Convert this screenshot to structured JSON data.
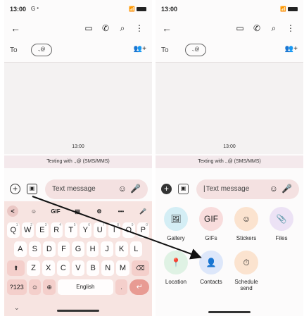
{
  "left": {
    "status": {
      "time": "13:00",
      "extra": "G ᵋ"
    },
    "to_label": "To",
    "to_chip": ".,@",
    "timestamp": "13:00",
    "texting_banner": "Texting with .,@ (SMS/MMS)",
    "compose_placeholder": "Text message",
    "keyboard": {
      "toolbar": [
        "<",
        "☺",
        "GIF",
        "▤",
        "⚙",
        "•••",
        "🎤"
      ],
      "row1": [
        {
          "key": "Q",
          "hint": "1"
        },
        {
          "key": "W",
          "hint": "2"
        },
        {
          "key": "E",
          "hint": "3"
        },
        {
          "key": "R",
          "hint": "4"
        },
        {
          "key": "T",
          "hint": "5"
        },
        {
          "key": "Y",
          "hint": "6"
        },
        {
          "key": "U",
          "hint": "7"
        },
        {
          "key": "I",
          "hint": "8"
        },
        {
          "key": "O",
          "hint": "9"
        },
        {
          "key": "P",
          "hint": "0"
        }
      ],
      "row2": [
        "A",
        "S",
        "D",
        "F",
        "G",
        "H",
        "J",
        "K",
        "L"
      ],
      "row3": [
        "Z",
        "X",
        "C",
        "V",
        "B",
        "N",
        "M"
      ],
      "row4": {
        "sym": "?123",
        "emoji": "☺",
        "globe": "⊕",
        "space": "English",
        "period": ".",
        "enter": "↵"
      },
      "shift": "⬆",
      "backspace": "⌫",
      "nav_chevron": "⌄"
    }
  },
  "right": {
    "status": {
      "time": "13:00"
    },
    "to_label": "To",
    "to_chip": ".,@",
    "timestamp": "13:00",
    "texting_banner": "Texting with .,@ (SMS/MMS)",
    "compose_placeholder": "Text message",
    "attachments": [
      {
        "label": "Gallery",
        "color": "#d4eef5",
        "icon": "🖼"
      },
      {
        "label": "GIFs",
        "color": "#f8dcdc",
        "icon": "GIF"
      },
      {
        "label": "Stickers",
        "color": "#fbe3cf",
        "icon": "☺"
      },
      {
        "label": "Files",
        "color": "#ece2f5",
        "icon": "📎"
      },
      {
        "label": "Location",
        "color": "#dff2e4",
        "icon": "📍"
      },
      {
        "label": "Contacts",
        "color": "#dde7fa",
        "icon": "👤"
      },
      {
        "label": "Schedule send",
        "color": "#fbe3cf",
        "icon": "⏱"
      }
    ]
  },
  "icons": {
    "back": "←",
    "video": "▭",
    "call": "✆",
    "search": "⌕",
    "more": "⋮",
    "add_contact": "👥+",
    "plus": "+",
    "gallery": "▣",
    "emoji": "☺",
    "mic": "🎤",
    "signal": "📶"
  },
  "colors": {
    "keyboard_bg": "#f7e4e1",
    "compose_bg": "#f4e1e1",
    "enter_key": "#e89b93"
  }
}
